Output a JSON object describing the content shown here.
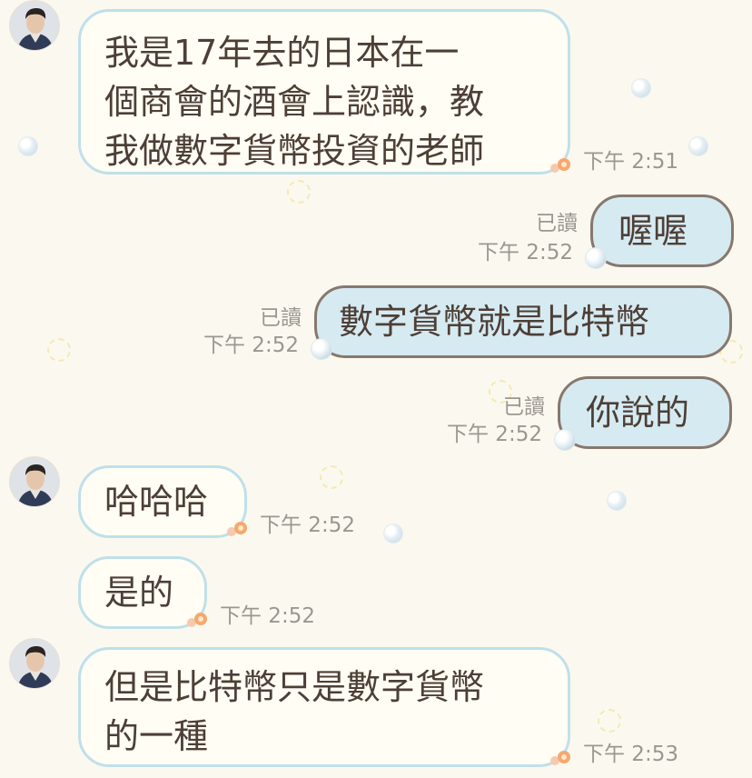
{
  "messages": [
    {
      "side": "in",
      "avatar": true,
      "text_lines": [
        "我是17年去的日本在一",
        "個商會的酒會上認識，教",
        "我做數字貨幣投資的老師"
      ],
      "time": "下午 2:51"
    },
    {
      "side": "out",
      "read": "已讀",
      "text": "喔喔",
      "time": "下午 2:52"
    },
    {
      "side": "out",
      "read": "已讀",
      "text": "數字貨幣就是比特幣",
      "time": "下午 2:52"
    },
    {
      "side": "out",
      "read": "已讀",
      "text": "你說的",
      "time": "下午 2:52"
    },
    {
      "side": "in",
      "avatar": true,
      "text": "哈哈哈",
      "time": "下午 2:52"
    },
    {
      "side": "in",
      "avatar": false,
      "text": "是的",
      "time": "下午 2:52"
    },
    {
      "side": "in",
      "avatar": true,
      "text_lines": [
        "但是比特幣只是數字貨幣",
        "的一種"
      ],
      "time": "下午 2:53"
    }
  ],
  "colors": {
    "background": "#fbf9ef",
    "incoming_bubble_fill": "#fffdf4",
    "incoming_bubble_border": "#bfe0ea",
    "outgoing_bubble_fill": "#d6eaf2",
    "outgoing_bubble_border": "#87786e",
    "text": "#4d3f36",
    "meta_text": "#9c9690"
  },
  "icons": [
    "avatar",
    "flower-sticker-icon",
    "bubble-ball-icon"
  ]
}
